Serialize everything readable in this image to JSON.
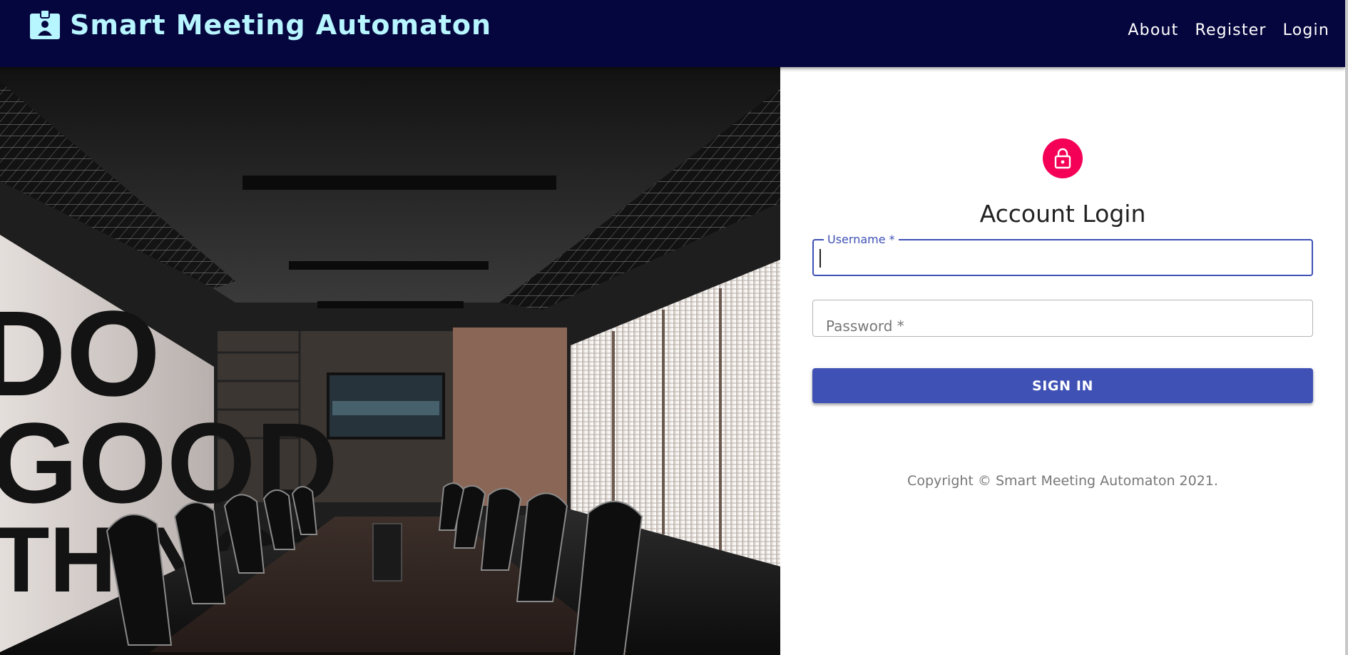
{
  "app": {
    "title": "Smart Meeting Automaton",
    "icon": "badge-icon"
  },
  "nav": {
    "items": [
      {
        "label": "About"
      },
      {
        "label": "Register"
      },
      {
        "label": "Login"
      }
    ]
  },
  "hero": {
    "wall_text": [
      "DO",
      "GOOD",
      "THINGS"
    ]
  },
  "login": {
    "icon": "lock-icon",
    "title": "Account Login",
    "username": {
      "label": "Username *",
      "value": ""
    },
    "password": {
      "label": "Password *",
      "value": ""
    },
    "submit_label": "SIGN IN",
    "copyright": "Copyright © Smart Meeting Automaton 2021."
  },
  "colors": {
    "appbar": "#06063f",
    "brand_text": "#b7f5ff",
    "primary": "#3f51b5",
    "avatar": "#f50057"
  }
}
